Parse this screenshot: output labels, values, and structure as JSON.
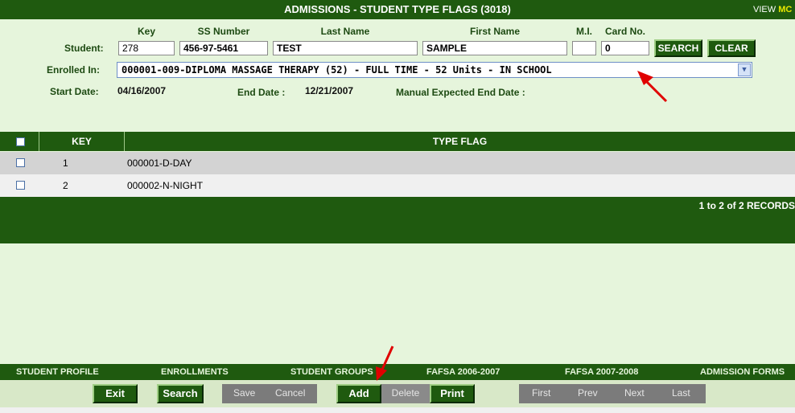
{
  "window": {
    "title": "ADMISSIONS - STUDENT TYPE FLAGS (3018)",
    "view_label": "VIEW",
    "view_mode": "MC"
  },
  "student_form": {
    "headers": {
      "key": "Key",
      "ss_number": "SS Number",
      "last_name": "Last Name",
      "first_name": "First Name",
      "mi": "M.I.",
      "card_no": "Card No."
    },
    "student_label": "Student:",
    "key_value": "278",
    "ss_number_value": "456-97-5461",
    "last_name_value": "TEST",
    "first_name_value": "SAMPLE",
    "mi_value": "",
    "card_no_value": "0",
    "search_button": "SEARCH",
    "clear_button": "CLEAR",
    "enrolled_label": "Enrolled In:",
    "enrolled_value": "000001-009-DIPLOMA MASSAGE THERAPY (52) - FULL TIME - 52 Units - IN SCHOOL",
    "start_date_label": "Start Date:",
    "start_date_value": "04/16/2007",
    "end_date_label": "End Date :",
    "end_date_value": "12/21/2007",
    "manual_end_label": "Manual Expected End Date :"
  },
  "grid": {
    "columns": [
      "KEY",
      "TYPE FLAG"
    ],
    "rows": [
      {
        "key": "1",
        "type_flag": "000001-D-DAY"
      },
      {
        "key": "2",
        "type_flag": "000002-N-NIGHT"
      }
    ],
    "records_text": "1 to 2 of 2 RECORDS"
  },
  "nav_tabs": [
    "STUDENT PROFILE",
    "ENROLLMENTS",
    "STUDENT GROUPS",
    "FAFSA 2006-2007",
    "FAFSA 2007-2008",
    "ADMISSION FORMS"
  ],
  "actions": {
    "exit": "Exit",
    "search": "Search",
    "save": "Save",
    "cancel": "Cancel",
    "add": "Add",
    "delete": "Delete",
    "print": "Print",
    "first": "First",
    "prev": "Prev",
    "next": "Next",
    "last": "Last"
  },
  "colors": {
    "brand_green": "#1f5a0f",
    "page_background": "#e6f5dc",
    "annotation_arrow": "#e00000"
  }
}
